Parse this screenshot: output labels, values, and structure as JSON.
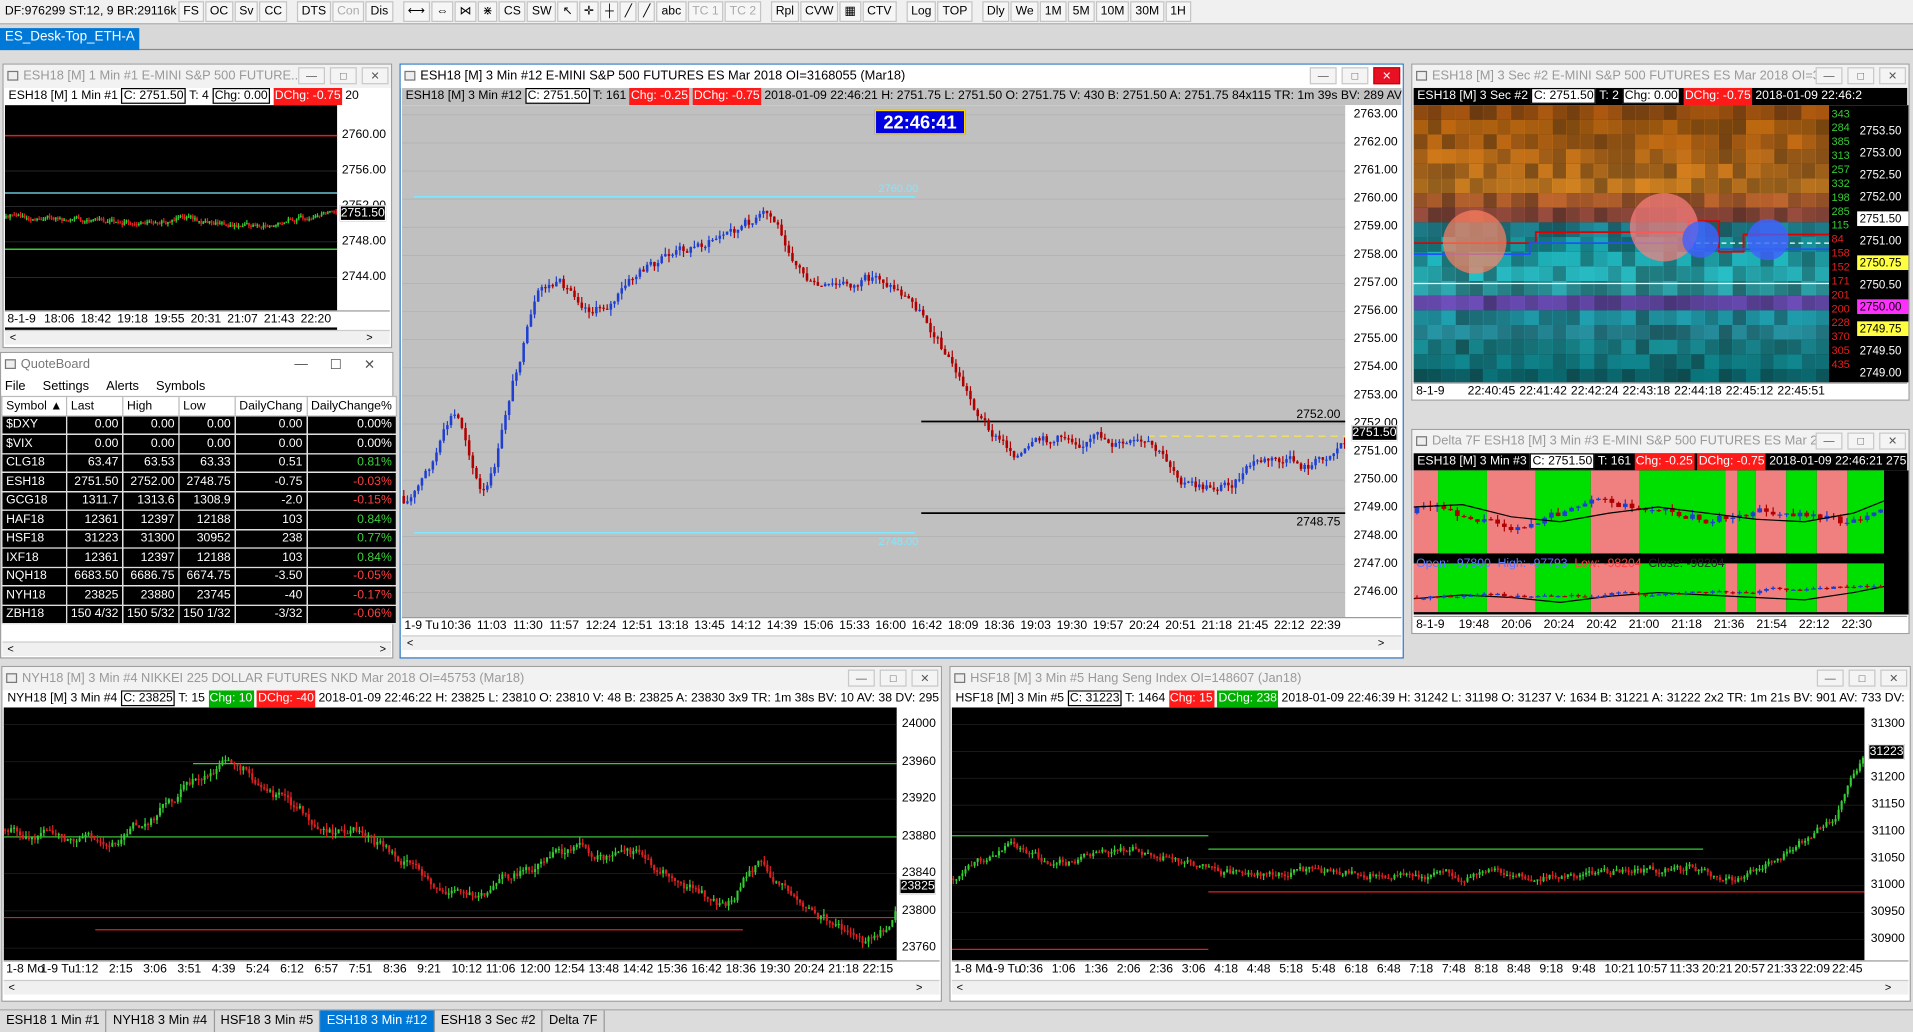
{
  "toolbar": {
    "status": "DF:976299  ST:12, 9  BR:29116k",
    "buttons": [
      "FS",
      "OC",
      "Sv",
      "CC",
      "DTS",
      "Con",
      "Dis"
    ],
    "disabled": [
      "Con"
    ],
    "tools_text": [
      "CS",
      "SW",
      "abc",
      "TC 1",
      "TC 2",
      "Rpl",
      "CVW",
      "CTV",
      "Log",
      "TOP",
      "Dly",
      "We",
      "1M",
      "5M",
      "10M",
      "30M",
      "1H"
    ]
  },
  "desktop_tab": "ES_Desk-Top_ETH-A",
  "win1": {
    "title": "ESH18 [M]  1 Min  #1  E-MINI S&P 500 FUTURE...",
    "hdr_sym": "ESH18 [M]  1 Min  #1",
    "hdr_c": "C: 2751.50",
    "hdr_t": "T: 4",
    "hdr_chg": "Chg: 0.00",
    "hdr_dchg": "DChg: -0.75",
    "hdr_tail": "20",
    "yticks": [
      "2760.00",
      "2756.00",
      "2752.00",
      "2748.00",
      "2744.00"
    ],
    "last": "2751.50",
    "xticks": [
      "8-1-9",
      "18:06",
      "18:42",
      "19:18",
      "19:55",
      "20:31",
      "21:07",
      "21:43",
      "22:20"
    ]
  },
  "quoteboard": {
    "title": "QuoteBoard",
    "menu": [
      "File",
      "Settings",
      "Alerts",
      "Symbols"
    ],
    "columns": [
      "Symbol",
      "Last",
      "High",
      "Low",
      "DailyChang",
      "DailyChange%"
    ],
    "rows": [
      [
        "$DXY",
        "0.00",
        "0.00",
        "0.00",
        "0.00",
        "0.00%"
      ],
      [
        "$VIX",
        "0.00",
        "0.00",
        "0.00",
        "0.00",
        "0.00%"
      ],
      [
        "CLG18",
        "63.47",
        "63.53",
        "63.33",
        "0.51",
        "0.81%"
      ],
      [
        "ESH18",
        "2751.50",
        "2752.00",
        "2748.75",
        "-0.75",
        "-0.03%"
      ],
      [
        "GCG18",
        "1311.7",
        "1313.6",
        "1308.9",
        "-2.0",
        "-0.15%"
      ],
      [
        "HAF18",
        "12361",
        "12397",
        "12188",
        "103",
        "0.84%"
      ],
      [
        "HSF18",
        "31223",
        "31300",
        "30952",
        "238",
        "0.77%"
      ],
      [
        "IXF18",
        "12361",
        "12397",
        "12188",
        "103",
        "0.84%"
      ],
      [
        "NQH18",
        "6683.50",
        "6686.75",
        "6674.75",
        "-3.50",
        "-0.05%"
      ],
      [
        "NYH18",
        "23825",
        "23880",
        "23745",
        "-40",
        "-0.17%"
      ],
      [
        "ZBH18",
        "150 4/32",
        "150 5/32",
        "150 1/32",
        "-3/32",
        "-0.06%"
      ]
    ]
  },
  "main": {
    "title": "ESH18 [M]  3 Min  #12  E-MINI S&P 500 FUTURES ES Mar 2018 OI=3168055 (Mar18)",
    "hdr_sym": "ESH18 [M]  3 Min  #12",
    "hdr_c": "C: 2751.50",
    "hdr_t": "T: 161",
    "hdr_chg": "Chg: -0.25",
    "hdr_dchg": "DChg: -0.75",
    "hdr_rest": "2018-01-09 22:46:21  H: 2751.75  L: 2751.50  O: 2751.75  V: 430  B: 2751.50  A: 2751.75  84x115  TR: 1m 39s  BV: 289  AV: 141",
    "clock": "22:46:41",
    "yticks": [
      "2763.00",
      "2762.00",
      "2761.00",
      "2760.00",
      "2759.00",
      "2758.00",
      "2757.00",
      "2756.00",
      "2755.00",
      "2754.00",
      "2753.00",
      "2752.00",
      "2751.00",
      "2750.00",
      "2749.00",
      "2748.00",
      "2747.00",
      "2746.00"
    ],
    "last": "2751.50",
    "label_hi": "2752.00",
    "label_lo": "2748.75",
    "cyan_hi": "2760.00",
    "cyan_lo": "2748.00",
    "xticks": [
      "1-9 Tu",
      "10:36",
      "11:03",
      "11:30",
      "11:57",
      "12:24",
      "12:51",
      "13:18",
      "13:45",
      "14:12",
      "14:39",
      "15:06",
      "15:33",
      "16:00",
      "16:42",
      "18:09",
      "18:36",
      "19:03",
      "19:30",
      "19:57",
      "20:24",
      "20:51",
      "21:18",
      "21:45",
      "22:12",
      "22:39"
    ],
    "ybound": [
      2745.2,
      2763.5
    ]
  },
  "win2": {
    "title": "ESH18 [M]  3 Sec  #2  E-MINI S&P 500 FUTURES ES Mar 2018 OI=31...",
    "hdr_sym": "ESH18 [M]  3 Sec  #2",
    "hdr_c": "C: 2751.50",
    "hdr_t": "T: 2",
    "hdr_chg": "Chg: 0.00",
    "hdr_dchg": "DChg: -0.75",
    "hdr_rest": "2018-01-09 22:46:2",
    "vols": [
      "343",
      "284",
      "385",
      "313",
      "257",
      "332",
      "198",
      "285",
      "115",
      "84",
      "158",
      "152",
      "171",
      "201",
      "200",
      "228",
      "370",
      "305",
      "435"
    ],
    "yticks": [
      "2753.50",
      "2753.00",
      "2752.50",
      "2752.00",
      "2751.50",
      "2751.00",
      "2750.75",
      "2750.50",
      "2750.00",
      "2749.75",
      "2749.50",
      "2749.00"
    ],
    "xticks": [
      "8-1-9",
      "22:40:45",
      "22:41:42",
      "22:42:24",
      "22:43:18",
      "22:44:18",
      "22:45:12",
      "22:45:51"
    ]
  },
  "win3": {
    "title": "Delta 7F  ESH18 [M]  3 Min  #3  E-MINI S&P 500 FUTURES ES Mar 20...",
    "hdr_sym": "ESH18 [M]  3 Min  #3",
    "hdr_c": "C: 2751.50",
    "hdr_t": "T: 161",
    "hdr_chg": "Chg: -0.25",
    "hdr_dchg": "DChg: -0.75",
    "hdr_rest": "2018-01-09 22:46:21  2751.",
    "sub_open": "Open: -97800",
    "sub_high": "High: -97793",
    "sub_low": "Low: -98204",
    "sub_close": "Close: -98204",
    "xticks": [
      "8-1-9",
      "19:48",
      "20:06",
      "20:24",
      "20:42",
      "21:00",
      "21:18",
      "21:36",
      "21:54",
      "22:12",
      "22:30"
    ]
  },
  "win4": {
    "title": "NYH18 [M]  3 Min  #4  NIKKEI 225 DOLLAR FUTURES NKD Mar 2018 OI=45753 (Mar18)",
    "hdr_sym": "NYH18 [M]  3 Min  #4",
    "hdr_c": "C: 23825",
    "hdr_t": "T: 15",
    "hdr_chg": "Chg: 10",
    "hdr_dchg": "DChg: -40",
    "hdr_rest": "2018-01-09 22:46:22  H: 23825  L: 23810  O: 23810  V: 48  B: 23825  A: 23830  3x9  TR: 1m 38s  BV: 10  AV: 38  DV: 2953  High",
    "yticks": [
      "24000",
      "23960",
      "23920",
      "23880",
      "23840",
      "23800",
      "23760"
    ],
    "last": "23825",
    "xticks": [
      "1-8 Mo",
      "1-9 Tu",
      "1:12",
      "2:15",
      "3:06",
      "3:51",
      "4:39",
      "5:24",
      "6:12",
      "6:57",
      "7:51",
      "8:36",
      "9:21",
      "10:12",
      "11:06",
      "12:00",
      "12:54",
      "13:48",
      "14:42",
      "15:36",
      "16:42",
      "18:36",
      "19:30",
      "20:24",
      "21:18",
      "22:15"
    ]
  },
  "win5": {
    "title": "HSF18 [M]  3 Min  #5  Hang Seng Index OI=148607 (Jan18)",
    "hdr_sym": "HSF18 [M]  3 Min  #5",
    "hdr_c": "C: 31223",
    "hdr_t": "T: 1464",
    "hdr_chg": "Chg: 15",
    "hdr_dchg": "DChg: 238",
    "hdr_rest": "2018-01-09 22:46:39  H: 31242  L: 31198  O: 31237  V: 1634  B: 31221  A: 31222  2x2  TR: 1m 21s  BV: 901  AV: 733  DV: 94177",
    "yticks": [
      "31300",
      "31250",
      "31200",
      "31150",
      "31100",
      "31050",
      "31000",
      "30950",
      "30900",
      "30850"
    ],
    "last": "31223",
    "xticks": [
      "1-8 Mo",
      "1-9 Tu",
      "0:36",
      "1:06",
      "1:36",
      "2:06",
      "2:36",
      "3:06",
      "4:18",
      "4:48",
      "5:18",
      "5:48",
      "6:18",
      "6:48",
      "7:18",
      "7:48",
      "8:18",
      "8:48",
      "9:18",
      "9:48",
      "10:21",
      "10:57",
      "11:33",
      "20:21",
      "20:57",
      "21:33",
      "22:09",
      "22:45"
    ]
  },
  "bottom_tabs": [
    "ESH18  1 Min  #1",
    "NYH18  3 Min  #4",
    "HSF18  3 Min  #5",
    "ESH18  3 Min  #12",
    "ESH18  3 Sec  #2",
    "Delta 7F"
  ],
  "selected_tab": "ESH18  3 Min  #12",
  "colors": {
    "up": "#1f3fd0",
    "down": "#c00000",
    "green": "#33cc33",
    "red": "#e02020",
    "cyan": "#7fe8ff"
  }
}
